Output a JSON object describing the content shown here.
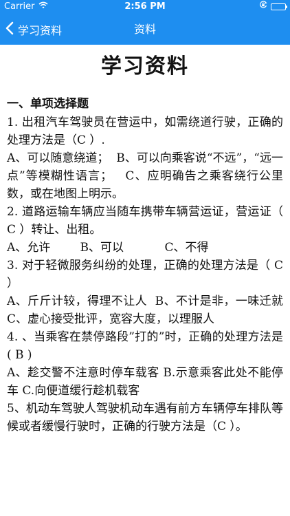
{
  "status_bar": {
    "carrier": "Carrier",
    "time": "2:56 PM"
  },
  "nav": {
    "back_label": "学习资料",
    "title": "资料"
  },
  "document": {
    "title": "学习资料",
    "section_heading": "一、单项选择题",
    "lines": [
      "1. 出租汽车驾驶员在营运中，如需绕道行驶，正确的处理方法是（C ）.",
      "A、可以随意绕道；  B、可以向乘客说“不远”，“远一点”等模糊性语言；   C、应明确告之乘客绕行公里数，或在地图上明示。",
      "2. 道路运输车辆应当随车携带车辆营运证，营运证（ C ）转让、出租。",
      "A、允许        B、可以           C、不得",
      "3. 对于轻微服务纠纷的处理，正确的处理方法是（ C ）",
      "A、斤斤计较，得理不让人  B、不计是非，一味迁就  C、虚心接受批评，宽容大度，以理服人",
      "4. 、当乘客在禁停路段”打的”时，正确的处理方法是( B )",
      "A、趁交警不注意时停车载客 B.示意乘客此处不能停车 C.向便道缓行趁机载客",
      "5、机动车驾驶人驾驶机动车遇有前方车辆停车排队等候或者缓慢行驶时，正确的行驶方法是（C ）。"
    ]
  },
  "colors": {
    "accent": "#1e8ef0",
    "text": "#111111",
    "background": "#ffffff"
  }
}
